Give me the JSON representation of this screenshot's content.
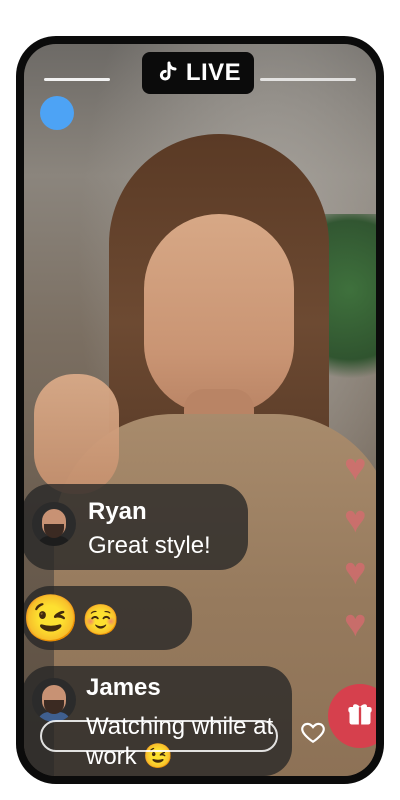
{
  "header": {
    "live_label": "LIVE"
  },
  "comments": [
    {
      "name": "Ryan",
      "message": "Great style!"
    },
    {
      "emoji_big": "😉",
      "emoji_small": "☺️"
    },
    {
      "name": "James",
      "message": "Watching while at work 😉"
    }
  ],
  "colors": {
    "accent_red": "#d6404d",
    "live_pill_bg": "#0b0b0b",
    "bubble_bg": "rgba(38,38,38,.78)",
    "status_dot": "#4da3f5",
    "floating_hearts": "#d96a6f"
  },
  "icons": {
    "live_logo": "tiktok-note-icon",
    "like": "heart-outline-icon",
    "gift": "gift-icon",
    "floating": "heart-icon"
  }
}
